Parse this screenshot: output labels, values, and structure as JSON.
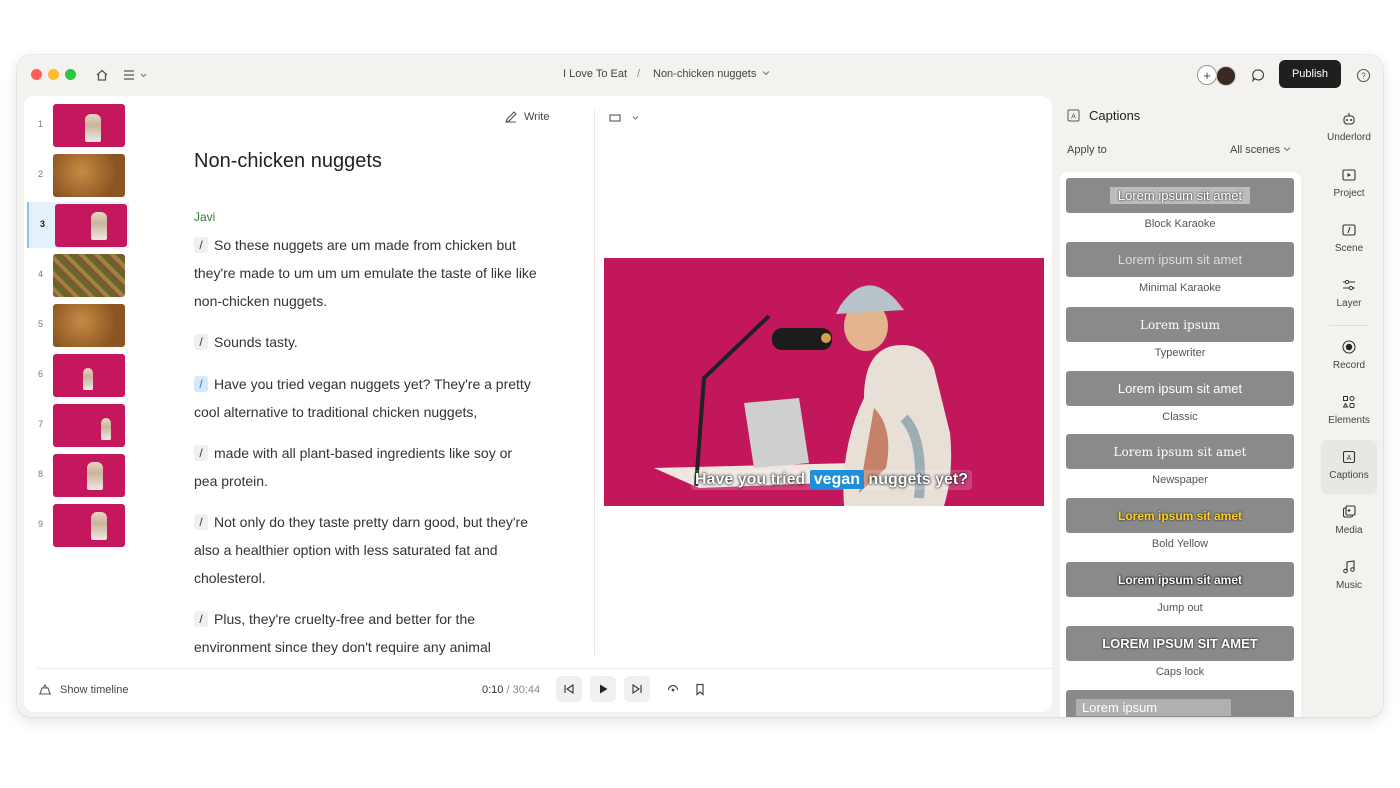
{
  "header": {
    "breadcrumb_project": "I Love To Eat",
    "breadcrumb_sep": "/",
    "breadcrumb_page": "Non-chicken nuggets",
    "publish": "Publish"
  },
  "scenes": [
    {
      "num": "1",
      "kind": "pink"
    },
    {
      "num": "2",
      "kind": "food"
    },
    {
      "num": "3",
      "kind": "pink",
      "active": true
    },
    {
      "num": "4",
      "kind": "beans"
    },
    {
      "num": "5",
      "kind": "food"
    },
    {
      "num": "6",
      "kind": "pink"
    },
    {
      "num": "7",
      "kind": "pink"
    },
    {
      "num": "8",
      "kind": "pink"
    },
    {
      "num": "9",
      "kind": "pink"
    }
  ],
  "editor": {
    "write_label": "Write",
    "title": "Non-chicken nuggets",
    "speaker": "Javi",
    "paragraphs": [
      "So these nuggets are um made from chicken but they're made to um um um emulate the taste of like like non-chicken nuggets.",
      "Sounds tasty.",
      "Have you tried vegan nuggets yet? They're a pretty cool alternative to traditional chicken nuggets,",
      "made with all plant-based ingredients like soy or pea protein.",
      "Not only do they taste pretty darn good, but they're also a healthier option with less saturated fat and cholesterol.",
      "Plus, they're cruelty-free and better for the environment since they don't require any animal"
    ]
  },
  "video": {
    "caption_before": "Have you tried",
    "caption_highlight": "vegan",
    "caption_after": "nuggets yet?"
  },
  "player": {
    "show_timeline": "Show timeline",
    "current": "0:10",
    "separator": " / ",
    "total": "30:44"
  },
  "captions_panel": {
    "title": "Captions",
    "apply_to": "Apply to",
    "scope": "All scenes",
    "styles": [
      {
        "preview": "Lorem ipsum sit amet",
        "name": "Block Karaoke"
      },
      {
        "preview": "Lorem ipsum sit amet",
        "name": "Minimal Karaoke"
      },
      {
        "preview": "Lorem ipsum",
        "name": "Typewriter"
      },
      {
        "preview": "Lorem ipsum sit amet",
        "name": "Classic"
      },
      {
        "preview": "Lorem ipsum sit amet",
        "name": "Newspaper"
      },
      {
        "preview": "Lorem ipsum sit amet",
        "name": "Bold Yellow"
      },
      {
        "preview": "Lorem ipsum sit amet",
        "name": "Jump out"
      },
      {
        "preview": "LOREM IPSUM SIT AMET",
        "name": "Caps lock"
      },
      {
        "preview": "Lorem ipsum",
        "name": ""
      }
    ]
  },
  "rail": [
    {
      "label": "Underlord",
      "icon": "robot-icon"
    },
    {
      "label": "Project",
      "icon": "project-icon"
    },
    {
      "label": "Scene",
      "icon": "scene-icon"
    },
    {
      "label": "Layer",
      "icon": "layer-icon"
    },
    {
      "label": "Record",
      "icon": "record-icon"
    },
    {
      "label": "Elements",
      "icon": "elements-icon"
    },
    {
      "label": "Captions",
      "icon": "captions-icon",
      "active": true
    },
    {
      "label": "Media",
      "icon": "media-icon"
    },
    {
      "label": "Music",
      "icon": "music-icon"
    }
  ]
}
